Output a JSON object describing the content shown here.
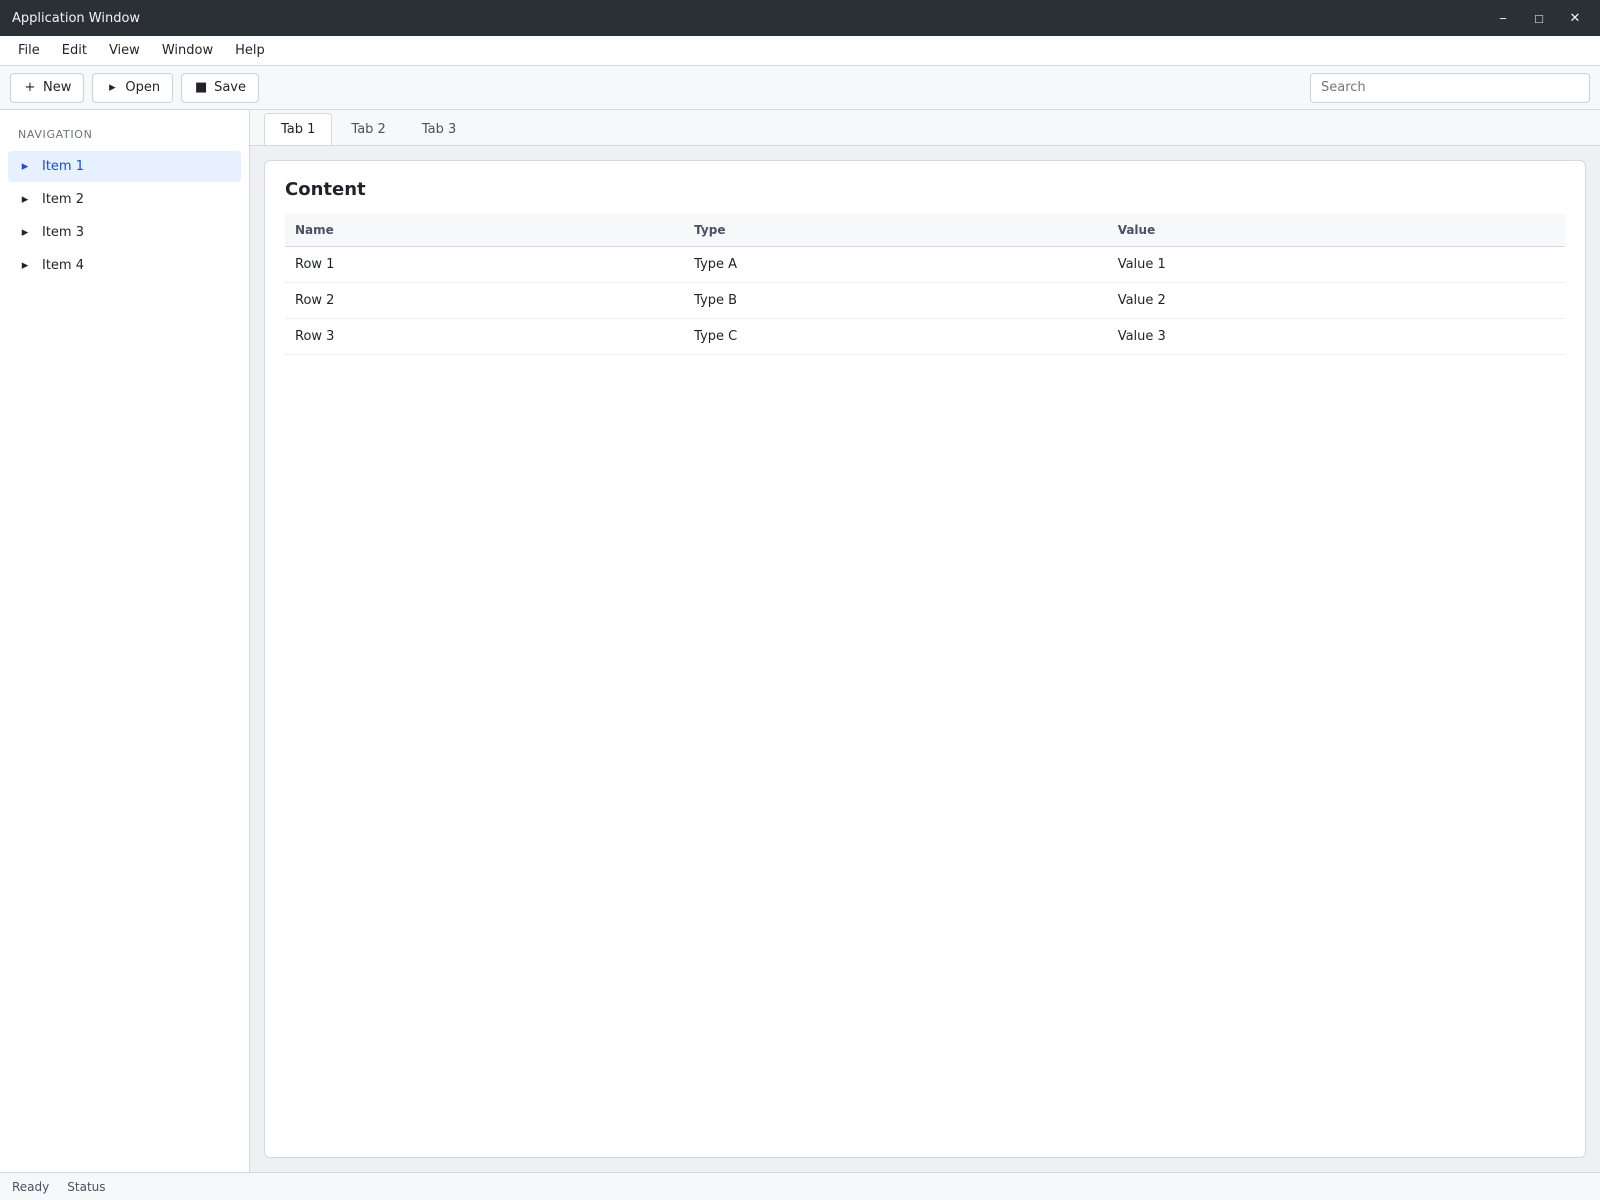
{
  "window": {
    "title": "Application Window"
  },
  "menu": [
    "File",
    "Edit",
    "View",
    "Window",
    "Help"
  ],
  "toolbar": {
    "new_label": "New",
    "open_label": "Open",
    "save_label": "Save",
    "search_placeholder": "Search"
  },
  "sidebar": {
    "heading": "Navigation",
    "items": [
      {
        "label": "Item 1",
        "icon": "folder-icon"
      },
      {
        "label": "Item 2",
        "icon": "folder-icon"
      },
      {
        "label": "Item 3",
        "icon": "folder-icon"
      },
      {
        "label": "Item 4",
        "icon": "folder-icon"
      }
    ]
  },
  "tabs": [
    "Tab 1",
    "Tab 2",
    "Tab 3"
  ],
  "main": {
    "heading": "Content",
    "columns": [
      "Name",
      "Type",
      "Value"
    ],
    "rows": [
      [
        "Row 1",
        "Type A",
        "Value 1"
      ],
      [
        "Row 2",
        "Type B",
        "Value 2"
      ],
      [
        "Row 3",
        "Type C",
        "Value 3"
      ]
    ]
  },
  "status": {
    "left": "Ready",
    "right": "Status"
  }
}
